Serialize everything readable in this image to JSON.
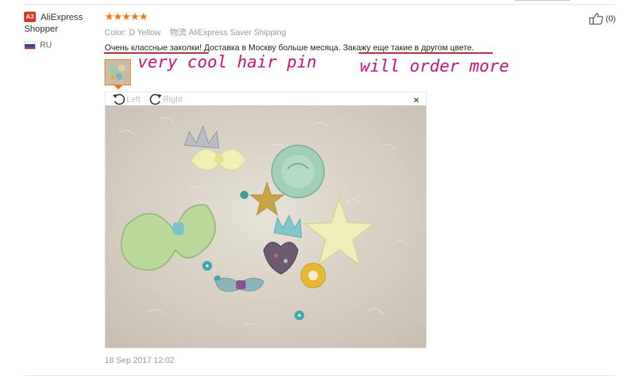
{
  "reviewer": {
    "badge": "A3",
    "name_line1": "AliExpress",
    "name_line2": "Shopper",
    "country": "RU",
    "flag_colors": [
      "#ffffff",
      "#1f4fb0",
      "#d52b1e"
    ]
  },
  "rating": {
    "stars": "★★★★★",
    "value": 5,
    "color": "#ff7200"
  },
  "order_info": {
    "color_label": "Color:",
    "color_value": "D Yellow",
    "shipping_label": "物流",
    "shipping_value": "AliExpress Saver Shipping"
  },
  "review_text": "Очень классные заколки! Доставка в Москву больше месяца. Закажу еще такие в другом цвете.",
  "annotations": {
    "note1": "very cool hair pin",
    "note2": "will order more",
    "color": "#d4117c"
  },
  "viewer": {
    "rotate_left_label": "Left",
    "rotate_right_label": "Right",
    "close_symbol": "×"
  },
  "helpful": {
    "icon": "thumbs-up-icon",
    "count": "(0)"
  },
  "date": "18 Sep 2017 12:02"
}
